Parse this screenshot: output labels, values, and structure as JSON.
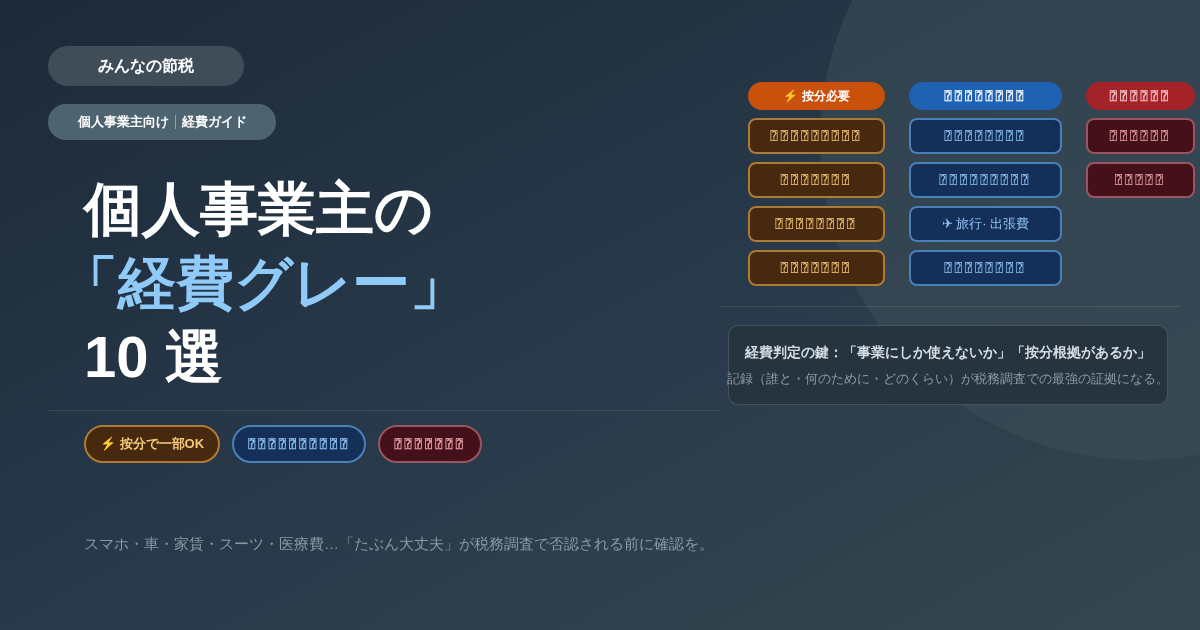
{
  "brand": "みんなの節税",
  "category": {
    "left": "個人事業主向け",
    "right": "経費ガイド"
  },
  "headline": {
    "line_1": "個人事業主の",
    "line_2": "「経費グレー」",
    "line_3": "10 選"
  },
  "legend": [
    {
      "kind": "orange",
      "label": "⚡ 按分で一部OK"
    },
    {
      "kind": "blue",
      "label": "⍰⍰⍰⍰⍰⍰⍰⍰⍰⍰"
    },
    {
      "kind": "red",
      "label": "⍰⍰⍰⍰⍰⍰⍰"
    }
  ],
  "columns": [
    {
      "kind": "orange",
      "header": {
        "label": "⚡ 按分必要"
      },
      "items": [
        {
          "label": "⍰⍰⍰⍰⍰⍰⍰⍰⍰"
        },
        {
          "label": "⍰⍰⍰⍰⍰⍰⍰"
        },
        {
          "label": "⍰⍰⍰⍰⍰⍰⍰⍰"
        },
        {
          "label": "⍰⍰⍰⍰⍰⍰⍰"
        }
      ]
    },
    {
      "kind": "blue",
      "header": {
        "label": "⍰⍰⍰⍰⍰⍰⍰⍰"
      },
      "items": [
        {
          "label": "⍰⍰⍰⍰⍰⍰⍰⍰"
        },
        {
          "label": "⍰⍰⍰⍰⍰⍰⍰⍰⍰"
        },
        {
          "label": "✈ 旅行· 出張費"
        },
        {
          "label": "⍰⍰⍰⍰⍰⍰⍰⍰"
        }
      ]
    },
    {
      "kind": "red",
      "header": {
        "label": "⍰⍰⍰⍰⍰⍰"
      },
      "items": [
        {
          "label": "⍰⍰⍰⍰⍰⍰"
        },
        {
          "label": "⍰⍰⍰⍰⍰"
        }
      ]
    }
  ],
  "key_note": {
    "title": "経費判定の鍵：「事業にしか使えないか」「按分根拠があるか」",
    "body": "記録（誰と・何のために・どのくらい）が税務調査での最強の証拠になる。"
  },
  "footer": "スマホ・車・家賃・スーツ・医療費…「たぶん大丈夫」が税務調査で否認される前に確認を。"
}
